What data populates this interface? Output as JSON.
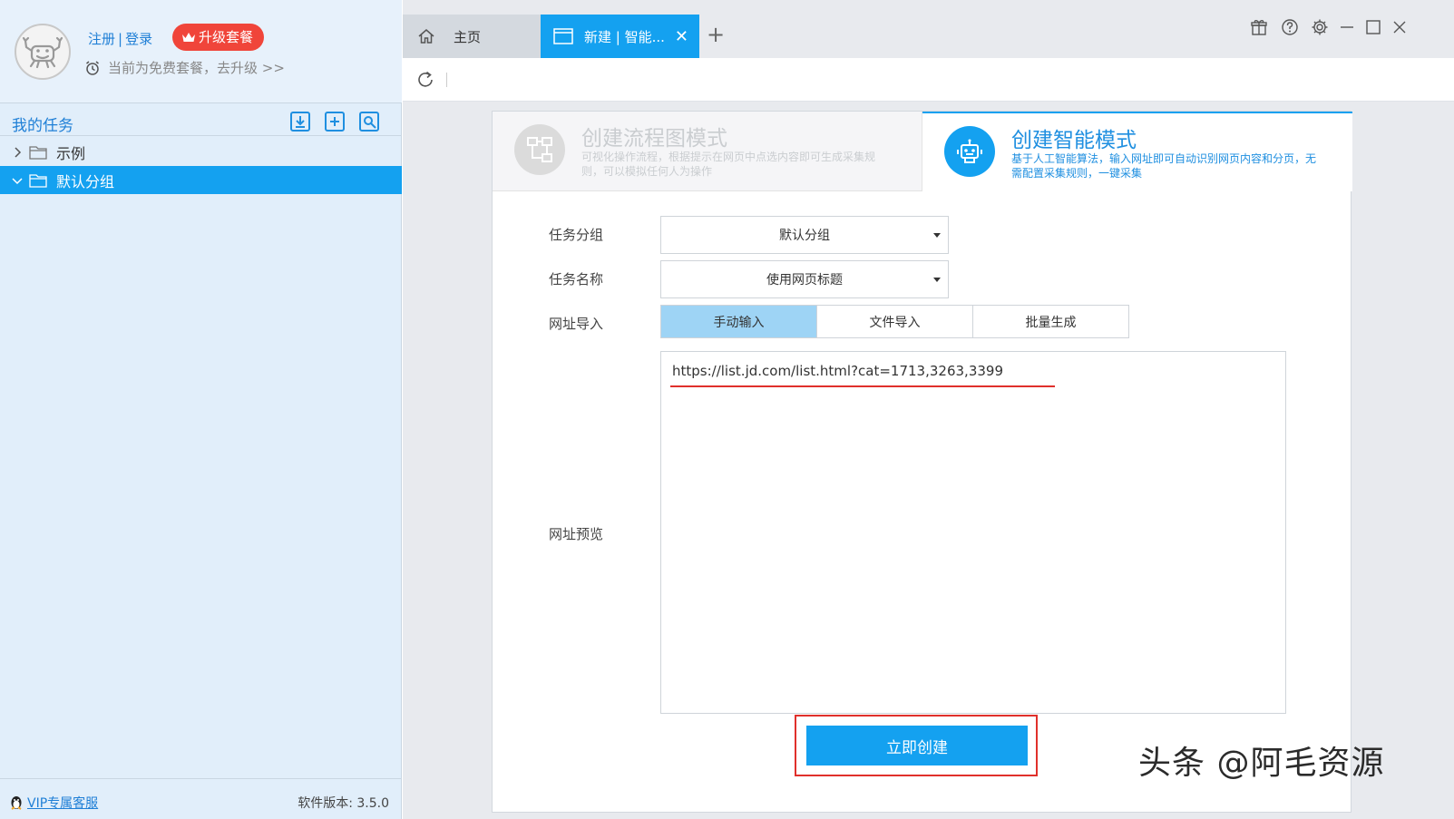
{
  "user": {
    "register_label": "注册",
    "separator": "|",
    "login_label": "登录",
    "upgrade_label": "升级套餐",
    "plan_text": "当前为免费套餐，去升级 >>"
  },
  "tasks": {
    "title": "我的任务",
    "header_icons": [
      "import-icon",
      "add-task-icon",
      "search-task-icon"
    ],
    "items": [
      {
        "label": "示例",
        "expanded": false,
        "selected": false
      },
      {
        "label": "默认分组",
        "expanded": true,
        "selected": true
      }
    ]
  },
  "footer": {
    "vip_label": "VIP专属客服",
    "version": "软件版本: 3.5.0"
  },
  "tabs": {
    "home_label": "主页",
    "new_label": "新建 | 智能...",
    "close_symbol": "✕",
    "add_symbol": "+"
  },
  "modes": {
    "flow": {
      "title": "创建流程图模式",
      "desc": "可视化操作流程，根据提示在网页中点选内容即可生成采集规则，可以模拟任何人为操作"
    },
    "smart": {
      "title": "创建智能模式",
      "desc": "基于人工智能算法，输入网址即可自动识别网页内容和分页，无需配置采集规则，一键采集"
    }
  },
  "form": {
    "group_label": "任务分组",
    "group_value": "默认分组",
    "name_label": "任务名称",
    "name_value": "使用网页标题",
    "import_label": "网址导入",
    "import_tabs": [
      "手动输入",
      "文件导入",
      "批量生成"
    ],
    "active_import_tab": 0,
    "preview_label": "网址预览",
    "url_value": "https://list.jd.com/list.html?cat=1713,3263,3399",
    "create_label": "立即创建"
  },
  "watermark": "头条 @阿毛资源",
  "colors": {
    "accent": "#14a1f0",
    "link": "#1f7fd6",
    "danger": "#e0302b",
    "upgrade": "#f0453a"
  }
}
